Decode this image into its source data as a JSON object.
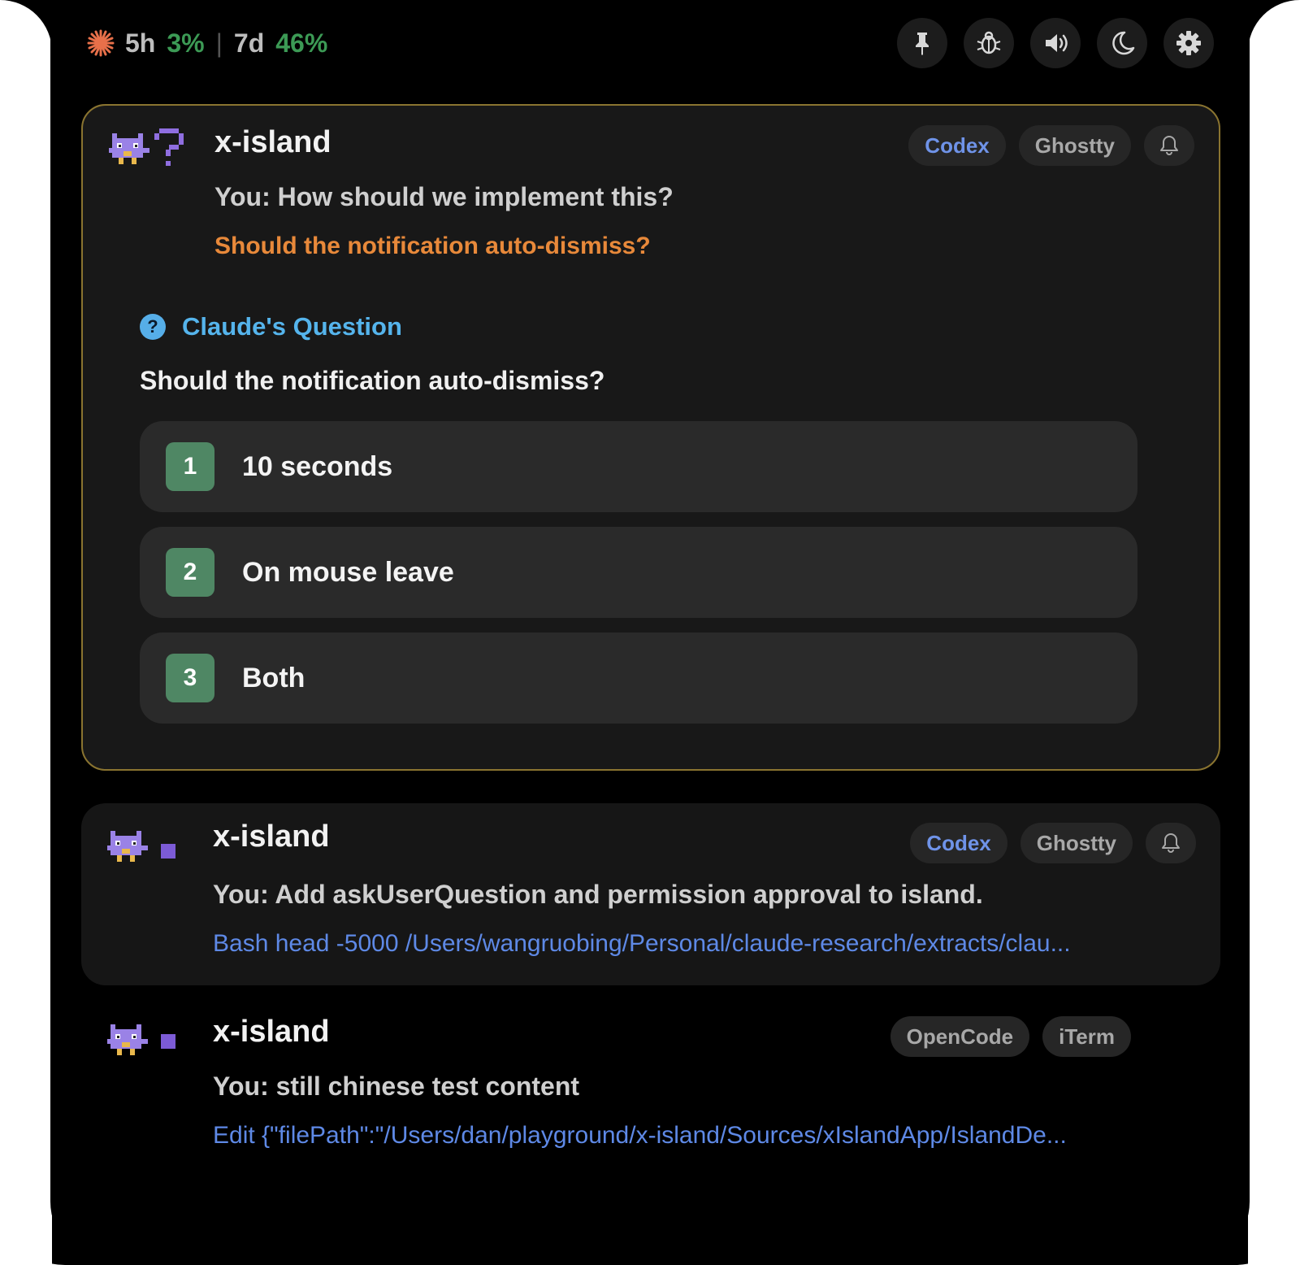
{
  "topbar": {
    "usage_5h_label": "5h",
    "usage_5h_pct": "3%",
    "separator": "|",
    "usage_7d_label": "7d",
    "usage_7d_pct": "46%",
    "icons": [
      "pin-icon",
      "bug-icon",
      "speaker-icon",
      "moon-icon",
      "gear-icon"
    ],
    "accent_green": "#3c9a55",
    "spark_color": "#e8704a"
  },
  "sessions": [
    {
      "title": "x-island",
      "status": "question",
      "tags": [
        "Codex",
        "Ghostty"
      ],
      "has_bell": true,
      "you_text": "You: How should we implement this?",
      "sub_text": "Should the notification auto-dismiss?",
      "question": {
        "header": "Claude's Question",
        "icon_glyph": "?",
        "text": "Should the notification auto-dismiss?",
        "options": [
          {
            "num": "1",
            "label": "10 seconds"
          },
          {
            "num": "2",
            "label": "On mouse leave"
          },
          {
            "num": "3",
            "label": "Both"
          }
        ]
      },
      "border_color": "#8a7430"
    },
    {
      "title": "x-island",
      "status": "working",
      "tags": [
        "Codex",
        "Ghostty"
      ],
      "has_bell": true,
      "you_text": "You: Add askUserQuestion and permission approval to island.",
      "sub_text": "Bash head -5000 /Users/wangruobing/Personal/claude-research/extracts/clau..."
    },
    {
      "title": "x-island",
      "status": "working",
      "tags": [
        "OpenCode",
        "iTerm"
      ],
      "has_bell": false,
      "you_text": "You: still chinese test content",
      "sub_text": "Edit {\"filePath\":\"/Users/dan/playground/x-island/Sources/xIslandApp/IslandDe..."
    }
  ]
}
